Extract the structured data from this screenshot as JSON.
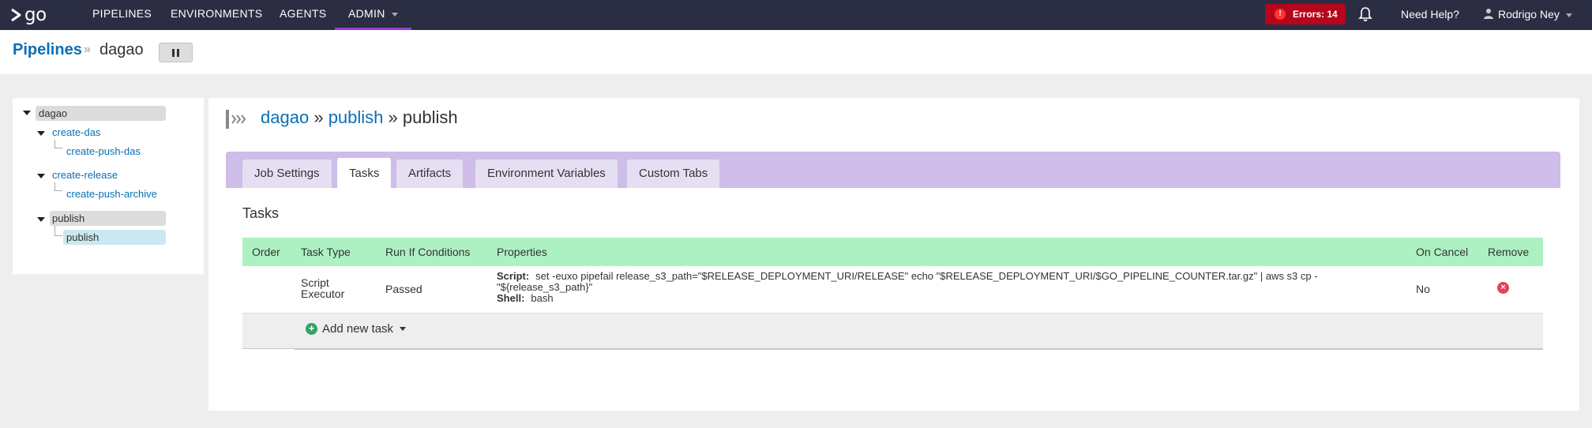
{
  "nav": {
    "logo_text": "go",
    "items": [
      "PIPELINES",
      "ENVIRONMENTS",
      "AGENTS",
      "ADMIN"
    ],
    "errors_label": "Errors: 14",
    "errors_icon": "!",
    "help_label": "Need Help?",
    "user_name": "Rodrigo Ney",
    "accent_color": "#943fcc",
    "error_color": "#b6051c"
  },
  "header": {
    "breadcrumb_root": "Pipelines",
    "breadcrumb_sep": "»",
    "pipeline_name": "dagao"
  },
  "tree": {
    "root": "dagao",
    "stages": [
      {
        "name": "create-das",
        "jobs": [
          "create-push-das"
        ]
      },
      {
        "name": "create-release",
        "jobs": [
          "create-push-archive"
        ]
      },
      {
        "name": "publish",
        "jobs": [
          "publish"
        ]
      }
    ]
  },
  "main": {
    "title_pipeline": "dagao",
    "title_sep1": "»",
    "title_stage": "publish",
    "title_sep2": "»",
    "title_job": "publish",
    "tabs": [
      "Job Settings",
      "Tasks",
      "Artifacts",
      "Environment Variables",
      "Custom Tabs"
    ],
    "active_tab": "Tasks",
    "section_heading": "Tasks",
    "columns": [
      "Order",
      "Task Type",
      "Run If Conditions",
      "Properties",
      "On Cancel",
      "Remove"
    ],
    "rows": [
      {
        "task_type": "Script Executor",
        "run_if": "Passed",
        "script_label": "Script:",
        "script_value": "set -euxo pipefail release_s3_path=\"$RELEASE_DEPLOYMENT_URI/RELEASE\" echo \"$RELEASE_DEPLOYMENT_URI/$GO_PIPELINE_COUNTER.tar.gz\" | aws s3 cp - \"${release_s3_path}\"",
        "shell_label": "Shell:",
        "shell_value": "bash",
        "on_cancel": "No"
      }
    ],
    "add_task_label": "Add new task"
  }
}
